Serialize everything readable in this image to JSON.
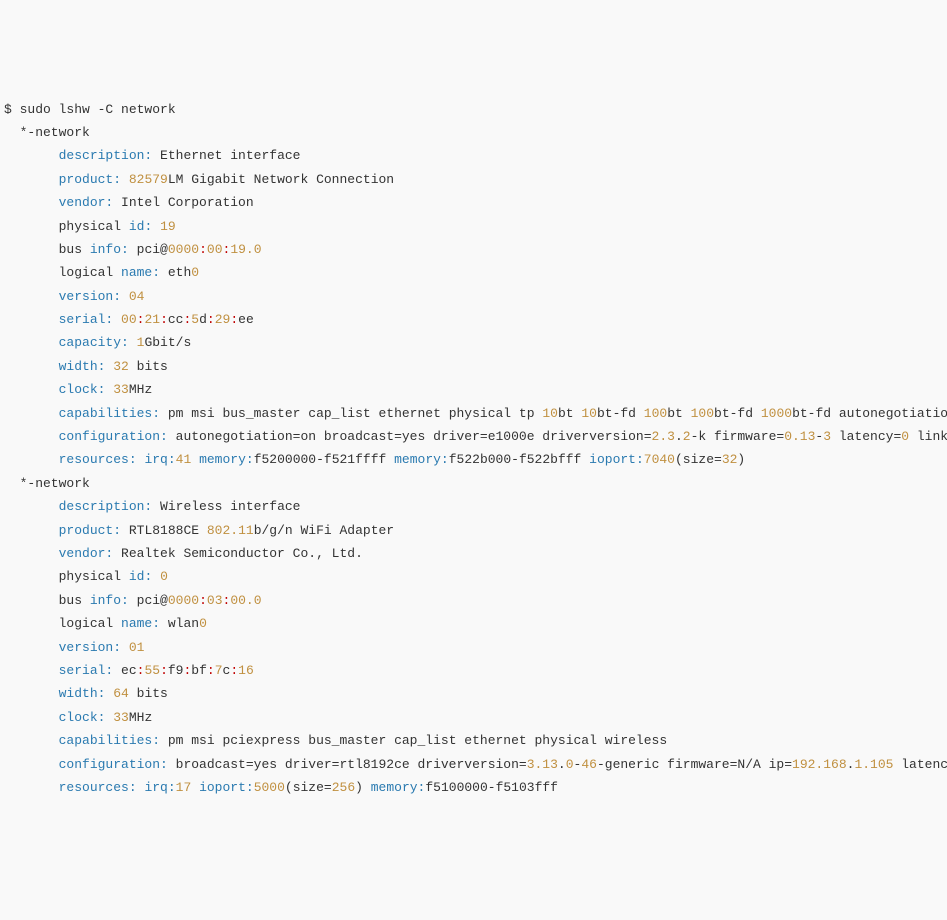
{
  "command": "$ sudo lshw -C network",
  "dev": [
    {
      "header": "  *-network",
      "description": {
        "label": "description:",
        "value": "Ethernet interface"
      },
      "product": {
        "label": "product:",
        "num": "82579",
        "rest": "LM Gigabit Network Connection"
      },
      "vendor": {
        "label": "vendor:",
        "value": "Intel Corporation"
      },
      "physical_id": {
        "label1": "physical",
        "label2": "id:",
        "value": "19"
      },
      "bus_info": {
        "label1": "bus",
        "label2": "info:",
        "prefix": "pci@",
        "a": "0000",
        "b": "00",
        "c": "19.0"
      },
      "logical_name": {
        "label1": "logical",
        "label2": "name:",
        "value": "eth",
        "suffix": "0"
      },
      "version": {
        "label": "version:",
        "value": "04"
      },
      "serial": {
        "label": "serial:",
        "parts": [
          "00",
          "21",
          "cc",
          "5",
          "d",
          "29",
          "ee"
        ]
      },
      "capacity": {
        "label": "capacity:",
        "num": "1",
        "unit": "Gbit/s"
      },
      "width": {
        "label": "width:",
        "num": "32",
        "unit": "bits"
      },
      "clock": {
        "label": "clock:",
        "num": "33",
        "unit": "MHz"
      },
      "capabilities": {
        "label": "capabilities:",
        "t1": "pm msi bus_master cap_list ethernet physical tp",
        "n1": "10",
        "t2": "bt",
        "n2": "10",
        "t3": "bt-fd",
        "n3": "100",
        "t4": "bt",
        "n4": "100",
        "t5": "bt-fd",
        "n5": "1000",
        "t6": "bt-fd autonegotiation"
      },
      "configuration": {
        "label": "configuration:",
        "t1": "autonegotiation=on broadcast=yes driver=e1000e driverversion=",
        "n1": "2.3",
        "t2": ".",
        "n2": "2",
        "t3": "-k firmware=",
        "n3": "0.13",
        "t4": "-",
        "n4": "3",
        "t5": " latency=",
        "n5": "0",
        "t6": " link="
      },
      "resources": {
        "label": "resources:",
        "t1": "irq:",
        "n1": "41",
        "t2": " memory:",
        "v2a": "f5200000-f521ffff",
        "t3": " memory:",
        "v3a": "f522b000-f522bfff",
        "t4": " ioport:",
        "n4": "7040",
        "t5": "(size=",
        "n5": "32",
        "t6": ")"
      }
    },
    {
      "header": "  *-network",
      "description": {
        "label": "description:",
        "value": "Wireless interface"
      },
      "product": {
        "label": "product:",
        "t1": "RTL8188CE",
        "n1": "802.11",
        "t2": "b/g/n WiFi Adapter"
      },
      "vendor": {
        "label": "vendor:",
        "value": "Realtek Semiconductor Co., Ltd."
      },
      "physical_id": {
        "label1": "physical",
        "label2": "id:",
        "value": "0"
      },
      "bus_info": {
        "label1": "bus",
        "label2": "info:",
        "prefix": "pci@",
        "a": "0000",
        "b": "03",
        "c": "00.0"
      },
      "logical_name": {
        "label1": "logical",
        "label2": "name:",
        "value": "wlan",
        "suffix": "0"
      },
      "version": {
        "label": "version:",
        "value": "01"
      },
      "serial": {
        "label": "serial:",
        "parts": [
          "ec",
          "55",
          "f9",
          "bf",
          "7",
          "c",
          "16"
        ]
      },
      "width": {
        "label": "width:",
        "num": "64",
        "unit": "bits"
      },
      "clock": {
        "label": "clock:",
        "num": "33",
        "unit": "MHz"
      },
      "capabilities": {
        "label": "capabilities:",
        "t1": "pm msi pciexpress bus_master cap_list ethernet physical wireless"
      },
      "configuration": {
        "label": "configuration:",
        "t1": "broadcast=yes driver=rtl8192ce driverversion=",
        "n1": "3.13",
        "t2": ".",
        "n2": "0",
        "t3": "-",
        "n3": "46",
        "t4": "-generic firmware=N/A ip=",
        "n4": "192.168",
        "t5": ".",
        "n5": "1.105",
        "t6": " latency"
      },
      "resources": {
        "label": "resources:",
        "t1": "irq:",
        "n1": "17",
        "t2": " ioport:",
        "n2": "5000",
        "t3": "(size=",
        "n3": "256",
        "t4": ")",
        "t5": " memory:",
        "v5": "f5100000-f5103fff"
      }
    }
  ]
}
